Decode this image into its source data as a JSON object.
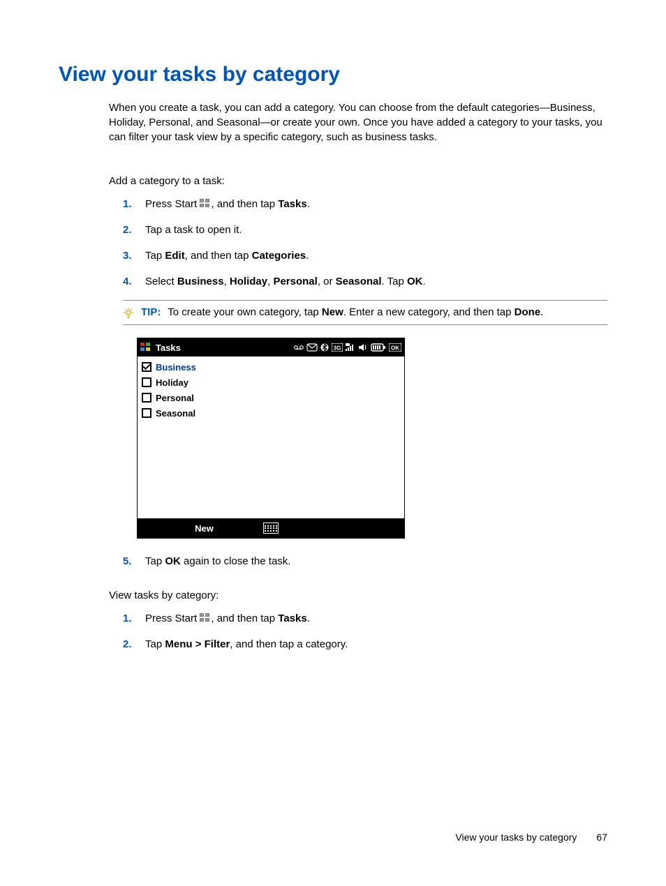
{
  "title": "View your tasks by category",
  "intro": "When you create a task, you can add a category. You can choose from the default categories—Business, Holiday, Personal, and Seasonal—or create your own. Once you have added a category to your tasks, you can filter your task view by a specific category, such as business tasks.",
  "section_a_head": "Add a category to a task:",
  "steps_a": {
    "s1_pre": "Press Start ",
    "s1_post": ", and then tap ",
    "s1_bold": "Tasks",
    "s1_end": ".",
    "s2": "Tap a task to open it.",
    "s3_a": "Tap ",
    "s3_b": "Edit",
    "s3_c": ", and then tap ",
    "s3_d": "Categories",
    "s3_e": ".",
    "s4_a": "Select ",
    "s4_b": "Business",
    "s4_c": ", ",
    "s4_d": "Holiday",
    "s4_e": ", ",
    "s4_f": "Personal",
    "s4_g": ", or ",
    "s4_h": "Seasonal",
    "s4_i": ". Tap ",
    "s4_j": "OK",
    "s4_k": ".",
    "s5_a": "Tap ",
    "s5_b": "OK",
    "s5_c": " again to close the task."
  },
  "nums": {
    "n1": "1.",
    "n2": "2.",
    "n3": "3.",
    "n4": "4.",
    "n5": "5."
  },
  "tip": {
    "label": "TIP:",
    "t1": "To create your own category, tap ",
    "t2": "New",
    "t3": ". Enter a new category, and then tap ",
    "t4": "Done",
    "t5": "."
  },
  "device": {
    "title": "Tasks",
    "categories": [
      {
        "label": "Business",
        "checked": true
      },
      {
        "label": "Holiday",
        "checked": false
      },
      {
        "label": "Personal",
        "checked": false
      },
      {
        "label": "Seasonal",
        "checked": false
      }
    ],
    "new_label": "New",
    "ok_label": "OK",
    "threeg": "3G"
  },
  "section_b_head": "View tasks by category:",
  "steps_b": {
    "s1_pre": "Press Start ",
    "s1_post": ", and then tap ",
    "s1_bold": "Tasks",
    "s1_end": ".",
    "s2_a": "Tap ",
    "s2_b": "Menu > Filter",
    "s2_c": ", and then tap a category."
  },
  "footer": {
    "text": "View your tasks by category",
    "page": "67"
  }
}
